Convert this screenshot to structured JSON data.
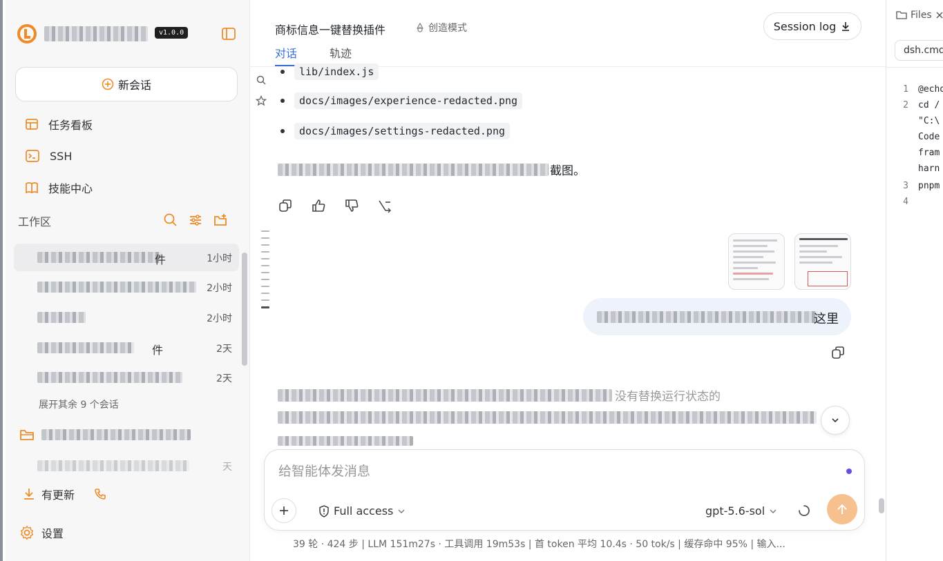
{
  "sidebar": {
    "version": "v1.0.0",
    "new_chat_label": "新会话",
    "nav": [
      {
        "label": "任务看板"
      },
      {
        "label": "SSH"
      },
      {
        "label": "技能中心"
      }
    ],
    "workspace_title": "工作区",
    "conversations": [
      {
        "tail": "件",
        "time": "1小时",
        "active": true
      },
      {
        "tail": "",
        "time": "2小时",
        "active": false
      },
      {
        "tail": "",
        "time": "2小时",
        "active": false
      },
      {
        "tail": "件",
        "time": "2天",
        "active": false
      },
      {
        "tail": "",
        "time": "2天",
        "active": false
      }
    ],
    "expand_label": "展开其余 9 个会话",
    "folder_extra_time": "天",
    "update_label": "有更新",
    "settings_label": "设置"
  },
  "header": {
    "title": "商标信息一键替换插件",
    "mode": "创造模式",
    "tabs": [
      "对话",
      "轨迹"
    ],
    "session_log": "Session log"
  },
  "messages": {
    "files": [
      "lib/index.js",
      "docs/images/experience-redacted.png",
      "docs/images/settings-redacted.png"
    ],
    "summary_tail": "截图。",
    "user_tail": "这里",
    "reply_fragment": "没有替换运行状态的"
  },
  "composer": {
    "placeholder": "给智能体发消息",
    "access": "Full access",
    "model": "gpt-5.6-sol"
  },
  "stats": "39 轮 · 424 步  |  LLM 151m27s · 工具调用 19m53s  |  首 token 平均 10.4s · 50 tok/s  |  缓存命中 95%  |  输入...",
  "files_panel": {
    "tab_label": "Files",
    "file_name": "dsh.cmd",
    "lines": [
      {
        "num": "1",
        "text": "@echo"
      },
      {
        "num": "2",
        "text": "cd /"
      },
      {
        "num": "",
        "text": "\"C:\\"
      },
      {
        "num": "",
        "text": "Code"
      },
      {
        "num": "",
        "text": "fram"
      },
      {
        "num": "",
        "text": "harn"
      },
      {
        "num": "3",
        "text": "pnpm"
      },
      {
        "num": "4",
        "text": ""
      }
    ]
  },
  "colors": {
    "accent": "#3b6fd6",
    "logo": "#f08a24",
    "send": "#f6c08f",
    "bubble": "#eef2fb"
  }
}
